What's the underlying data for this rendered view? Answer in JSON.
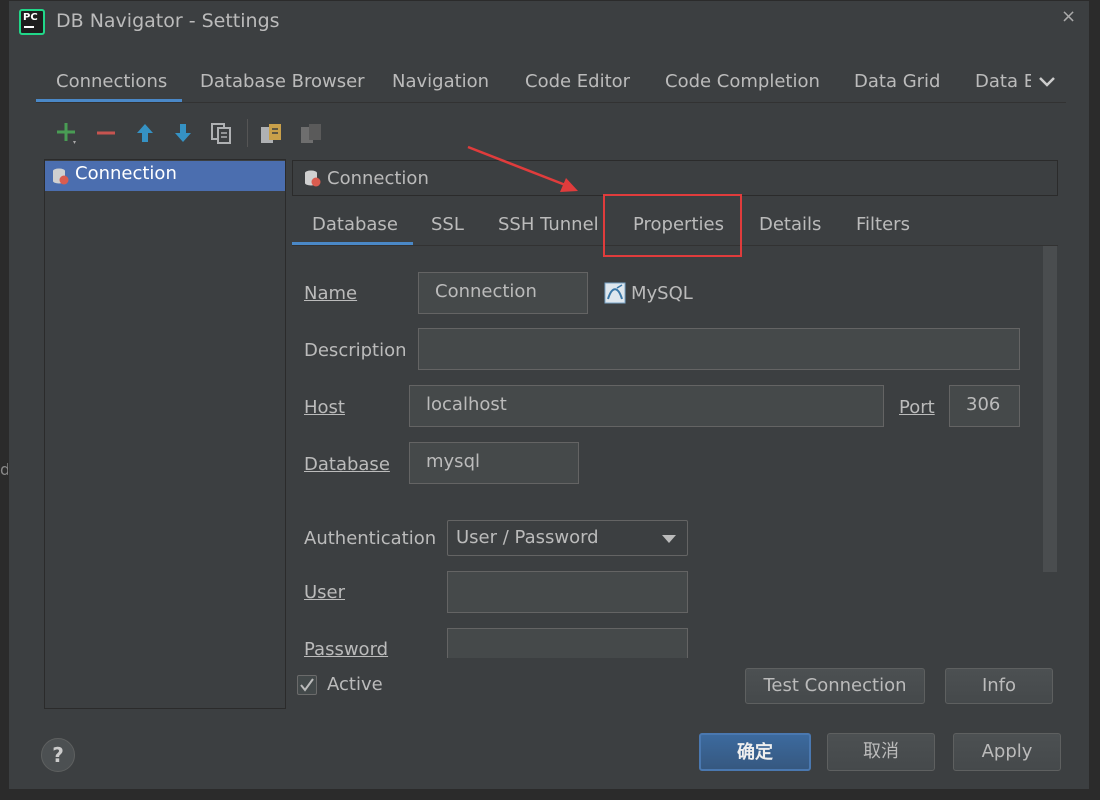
{
  "window": {
    "title": "DB Navigator - Settings"
  },
  "main_tabs": [
    {
      "label": "Connections"
    },
    {
      "label": "Database Browser"
    },
    {
      "label": "Navigation"
    },
    {
      "label": "Code Editor"
    },
    {
      "label": "Code Completion"
    },
    {
      "label": "Data Grid"
    },
    {
      "label": "Data E"
    }
  ],
  "connection_list": {
    "items": [
      {
        "label": "Connection"
      }
    ]
  },
  "connection_header": {
    "title": "Connection"
  },
  "sub_tabs": [
    {
      "label": "Database"
    },
    {
      "label": "SSL"
    },
    {
      "label": "SSH Tunnel"
    },
    {
      "label": "Properties"
    },
    {
      "label": "Details"
    },
    {
      "label": "Filters"
    }
  ],
  "form": {
    "name_label": "Name",
    "name_value": "Connection",
    "db_type": "MySQL",
    "description_label": "Description",
    "description_value": "",
    "host_label": "Host",
    "host_value": "localhost",
    "port_label": "Port",
    "port_value": "306",
    "database_label": "Database",
    "database_value": "mysql",
    "auth_label": "Authentication",
    "auth_value": "User / Password",
    "user_label": "User",
    "user_value": "",
    "password_label": "Password",
    "password_value": ""
  },
  "active": {
    "label": "Active",
    "checked": true
  },
  "buttons": {
    "test_connection": "Test Connection",
    "info": "Info",
    "ok": "确定",
    "cancel": "取消",
    "apply": "Apply"
  },
  "icons": {
    "app": "pycharm-app-icon",
    "close": "close-icon",
    "overflow": "chevron-down-icon",
    "help": "help-icon"
  },
  "colors": {
    "annotation_red": "#e03c3c",
    "selection": "#4b6eaf",
    "tab_underline": "#4a88c7",
    "default_button": "#365880"
  }
}
